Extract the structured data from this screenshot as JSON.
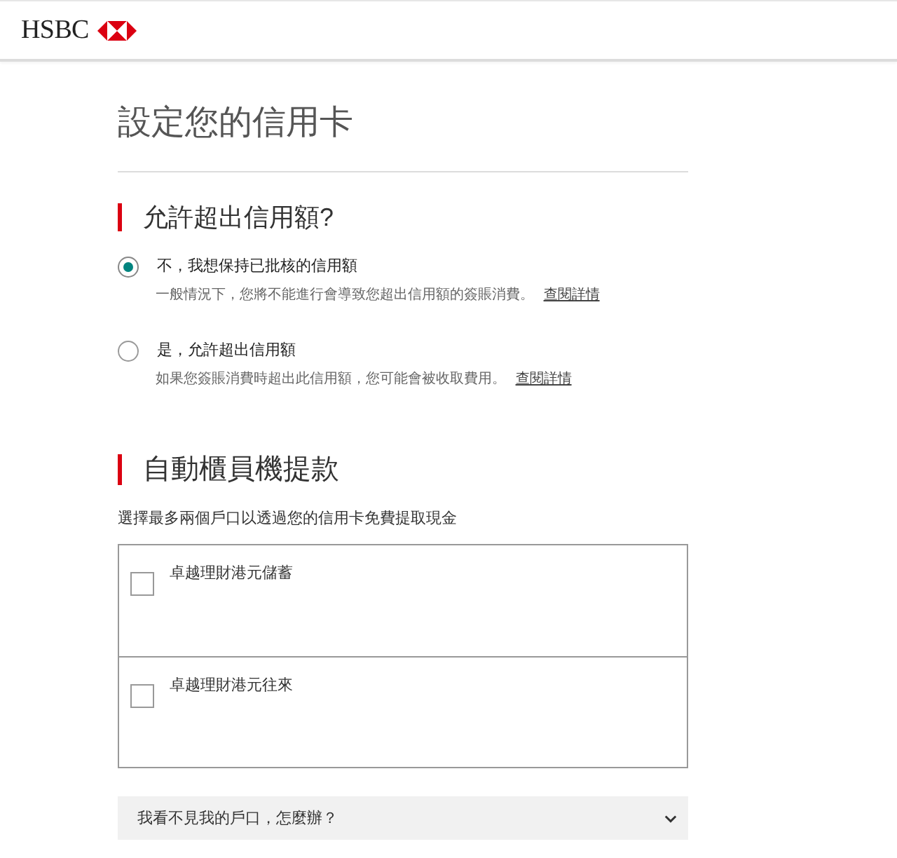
{
  "header": {
    "logo_text": "HSBC"
  },
  "page_title": "設定您的信用卡",
  "overlimit": {
    "heading": "允許超出信用額?",
    "options": [
      {
        "label": "不，我想保持已批核的信用額",
        "description": "一般情況下，您將不能進行會導致您超出信用額的簽賬消費。",
        "link": "查閱詳情",
        "selected": true
      },
      {
        "label": "是，允許超出信用額",
        "description": "如果您簽賬消費時超出此信用額，您可能會被收取費用。",
        "link": "查閱詳情",
        "selected": false
      }
    ]
  },
  "atm": {
    "heading": "自動櫃員機提款",
    "instruction": "選擇最多兩個戶口以透過您的信用卡免費提取現金",
    "accounts": [
      {
        "label": "卓越理財港元儲蓄",
        "checked": false
      },
      {
        "label": "卓越理財港元往來",
        "checked": false
      }
    ]
  },
  "faq": {
    "question": "我看不見我的戶口，怎麼辦？",
    "expanded": false
  }
}
